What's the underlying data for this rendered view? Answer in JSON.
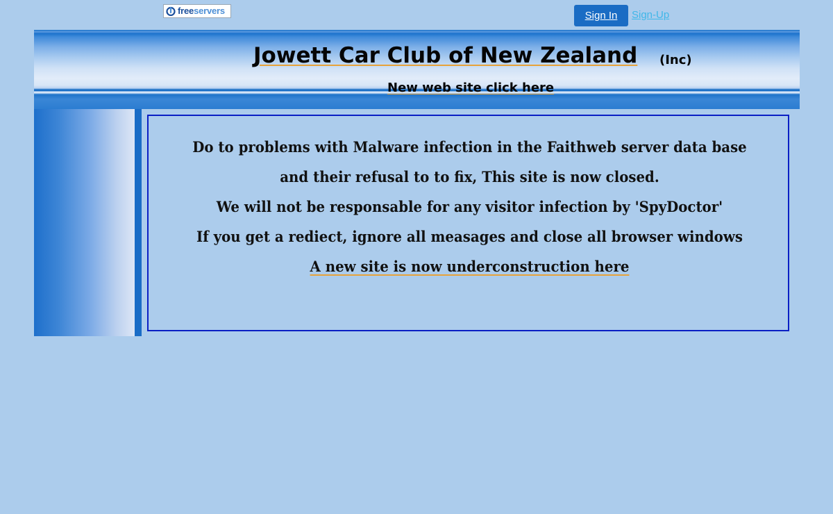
{
  "topbar": {
    "logo_part1": "free",
    "logo_part2": "servers",
    "sign_in": "Sign In",
    "sign_up": "Sign-Up"
  },
  "header": {
    "title": "Jowett Car Club of New Zealand",
    "title_suffix": "(Inc)",
    "new_site_link": "New web site click here"
  },
  "notice": {
    "lines": [
      "Do to problems with Malware infection in the Faithweb server data base",
      "and their refusal to to fix, This site is now closed.",
      "We will not be responsable for any visitor infection by 'SpyDoctor'",
      "If you get a rediect, ignore all measages and close all browser windows"
    ],
    "link": "A new site is now underconstruction here"
  },
  "colors": {
    "page_background": "#acccec",
    "accent_blue": "#1a6cc4",
    "notice_border": "#0a1fc4",
    "link_underline": "#e7a23a",
    "signup_link": "#3fb7e9"
  },
  "icons": {
    "logo": "freeservers-logo-icon"
  }
}
